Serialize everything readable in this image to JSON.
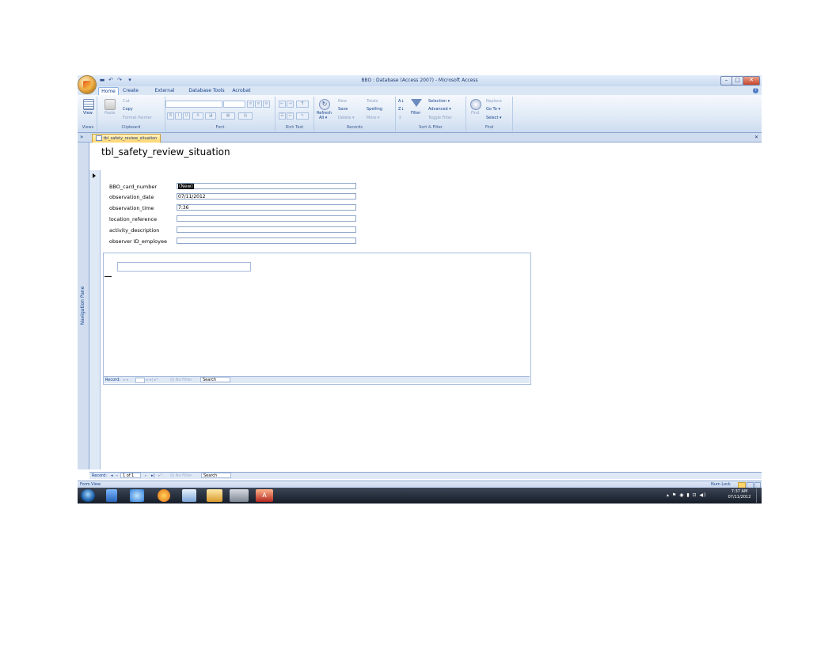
{
  "window": {
    "title": "BBO : Database (Access 2007) - Microsoft Access",
    "controls": [
      "–",
      "□",
      "✕"
    ],
    "qat": [
      "▬",
      "↶",
      "↷",
      "▾"
    ]
  },
  "ribbon": {
    "tabs": [
      "Home",
      "Create",
      "External Data",
      "Database Tools",
      "Acrobat"
    ],
    "active_tab": "Home",
    "groups": {
      "views": {
        "label": "Views",
        "view": "View"
      },
      "clipboard": {
        "label": "Clipboard",
        "paste": "Paste",
        "cut": "Cut",
        "copy": "Copy",
        "format_painter": "Format Painter"
      },
      "font": {
        "label": "Font",
        "bold": "B",
        "italic": "I",
        "underline": "U"
      },
      "rich_text": {
        "label": "Rich Text"
      },
      "records": {
        "label": "Records",
        "refresh": "Refresh",
        "refresh_sub": "All ▾",
        "new": "New",
        "save": "Save",
        "delete": "Delete ▾",
        "totals": "Totals",
        "spelling": "Spelling",
        "more": "More ▾"
      },
      "sort_filter": {
        "label": "Sort & Filter",
        "filter": "Filter",
        "selection": "Selection ▾",
        "advanced": "Advanced ▾",
        "toggle_filter": "Toggle Filter"
      },
      "find": {
        "label": "Find",
        "find": "Find",
        "replace": "Replace",
        "goto": "Go To ▾",
        "select": "Select ▾"
      }
    }
  },
  "document": {
    "tab": "tbl_safety_review_situation",
    "close": "✕",
    "nav_toggle": "»"
  },
  "nav_pane": {
    "label": "Navigation Pane"
  },
  "form": {
    "title": "tbl_safety_review_situation",
    "fields": [
      {
        "label": "BBO_card_number",
        "value": "(New)"
      },
      {
        "label": "observation_date",
        "value": "07/11/2012"
      },
      {
        "label": "observation_time",
        "value": "7:36"
      },
      {
        "label": "location_reference",
        "value": ""
      },
      {
        "label": "activity_description",
        "value": ""
      },
      {
        "label": "observer ID_employee",
        "value": ""
      }
    ]
  },
  "subform_nav": {
    "record_label": "Record:",
    "buttons": "◂ ◂",
    "buttons_after": "▸ ▸| ▸*",
    "filter": "No Filter",
    "search": "Search"
  },
  "main_nav": {
    "record_label": "Record:",
    "first": "◂",
    "prev": "◂",
    "position": "1 of 1",
    "next": "▸",
    "last": "▸|",
    "new": "▸*",
    "filter": "No Filter",
    "search": "Search"
  },
  "status": {
    "left": "Form View",
    "num_lock": "Num Lock"
  },
  "taskbar": {
    "time": "7:37 AM",
    "date": "07/11/2012",
    "tray": "▴ ⚑ ◉ ▮ ⊡ ◀)",
    "buttons": [
      "start",
      "media",
      "ie",
      "firefox",
      "explorer",
      "folder",
      "tools",
      "access"
    ],
    "access_label": "A"
  }
}
